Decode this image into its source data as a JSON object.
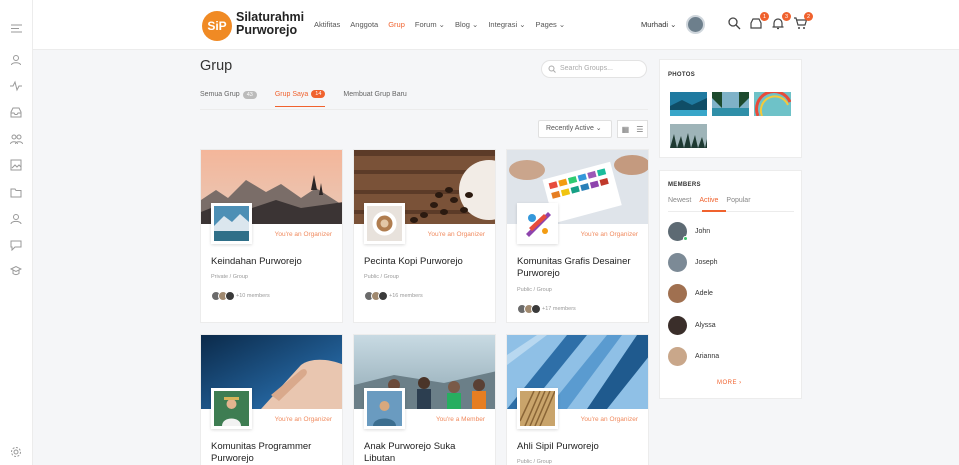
{
  "brand": {
    "logo_text": "SiP",
    "line1": "Silaturahmi",
    "line2": "Purworejo"
  },
  "nav": [
    "Aktifitas",
    "Anggota",
    "Grup",
    "Forum ⌄",
    "Blog ⌄",
    "Integrasi ⌄",
    "Pages ⌄"
  ],
  "nav_active": "Grup",
  "user": {
    "name": "Murhadi ⌄"
  },
  "badges": {
    "messages": "1",
    "notifications": "3",
    "cart": "2"
  },
  "page": {
    "title": "Grup",
    "search_placeholder": "Search Groups...",
    "tabs": [
      {
        "label": "Semua Grup",
        "count": "43"
      },
      {
        "label": "Grup Saya",
        "count": "14"
      },
      {
        "label": "Membuat Grup Baru",
        "count": ""
      }
    ],
    "sort": "Recently Active  ⌄"
  },
  "cards": [
    {
      "role": "You're an Organizer",
      "title": "Keindahan Purworejo",
      "meta": "Private / Group",
      "members": "+10 members"
    },
    {
      "role": "You're an Organizer",
      "title": "Pecinta Kopi Purworejo",
      "meta": "Public / Group",
      "members": "+16 members"
    },
    {
      "role": "You're an Organizer",
      "title": "Komunitas Grafis Desainer Purworejo",
      "meta": "Public / Group",
      "members": "+17 members"
    },
    {
      "role": "You're an Organizer",
      "title": "Komunitas Programmer Purworejo",
      "meta": "",
      "members": ""
    },
    {
      "role": "You're a Member",
      "title": "Anak Purworejo Suka Libutan",
      "meta": "",
      "members": ""
    },
    {
      "role": "You're an Organizer",
      "title": "Ahli Sipil Purworejo",
      "meta": "Public / Group",
      "members": ""
    }
  ],
  "photos": {
    "title": "PHOTOS"
  },
  "members": {
    "title": "MEMBERS",
    "tabs": [
      "Newest",
      "Active",
      "Popular"
    ],
    "active_tab": "Active",
    "list": [
      "John",
      "Joseph",
      "Adele",
      "Alyssa",
      "Arianna"
    ],
    "more": "MORE  ›"
  },
  "colors": {
    "accent": "#f0622e",
    "logo": "#f08a24"
  }
}
